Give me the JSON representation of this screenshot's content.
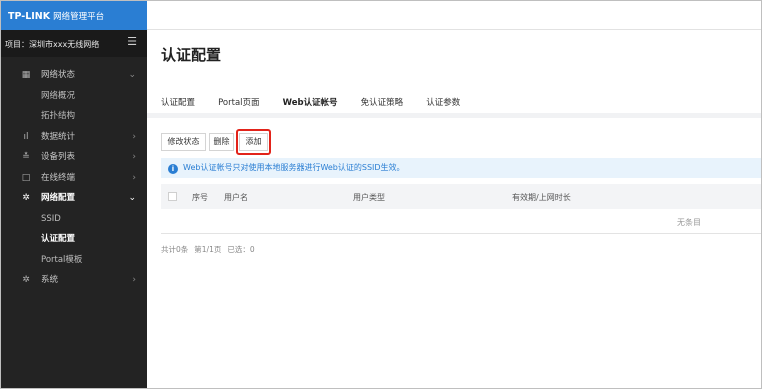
{
  "sidebar": {
    "brand": "TP-LINK",
    "brand_sub": "网络管理平台",
    "project": "项目：深圳市xxx无线网络",
    "menu_icon": "hamburger-icon",
    "items": [
      {
        "label": "网络状态",
        "icon": "dashboard-icon",
        "arrow": "⌄"
      },
      {
        "label": "网络概况"
      },
      {
        "label": "拓扑结构"
      },
      {
        "label": "数据统计",
        "icon": "bar-chart-icon",
        "arrow": "›"
      },
      {
        "label": "设备列表",
        "icon": "device-list-icon",
        "arrow": "›"
      },
      {
        "label": "在线终端",
        "icon": "monitor-icon",
        "arrow": "›"
      },
      {
        "label": "网络配置",
        "icon": "gear-icon",
        "arrow": "⌄"
      },
      {
        "label": "SSID"
      },
      {
        "label": "认证配置"
      },
      {
        "label": "Portal模板"
      },
      {
        "label": "系统",
        "icon": "gear-icon",
        "arrow": "›"
      }
    ]
  },
  "main": {
    "title": "认证配置",
    "tabs": [
      {
        "label": "认证配置"
      },
      {
        "label": "Portal页面"
      },
      {
        "label": "Web认证帐号"
      },
      {
        "label": "免认证策略"
      },
      {
        "label": "认证参数"
      }
    ],
    "active_tab": "Web认证帐号",
    "toolbar": {
      "edit_status": "修改状态",
      "delete": "删除",
      "add": "添加"
    },
    "notice": "Web认证帐号只对使用本地服务器进行Web认证的SSID生效。",
    "table": {
      "columns": [
        "序号",
        "用户名",
        "用户类型",
        "有效期/上网时长"
      ],
      "empty_text": "无条目"
    },
    "footer": {
      "total": "共计0条",
      "page": "第1/1页",
      "selected": "已选：0"
    }
  },
  "colors": {
    "brand_blue": "#2a7ed3",
    "sidebar_bg": "#232323",
    "highlight_red": "#e2231a"
  }
}
